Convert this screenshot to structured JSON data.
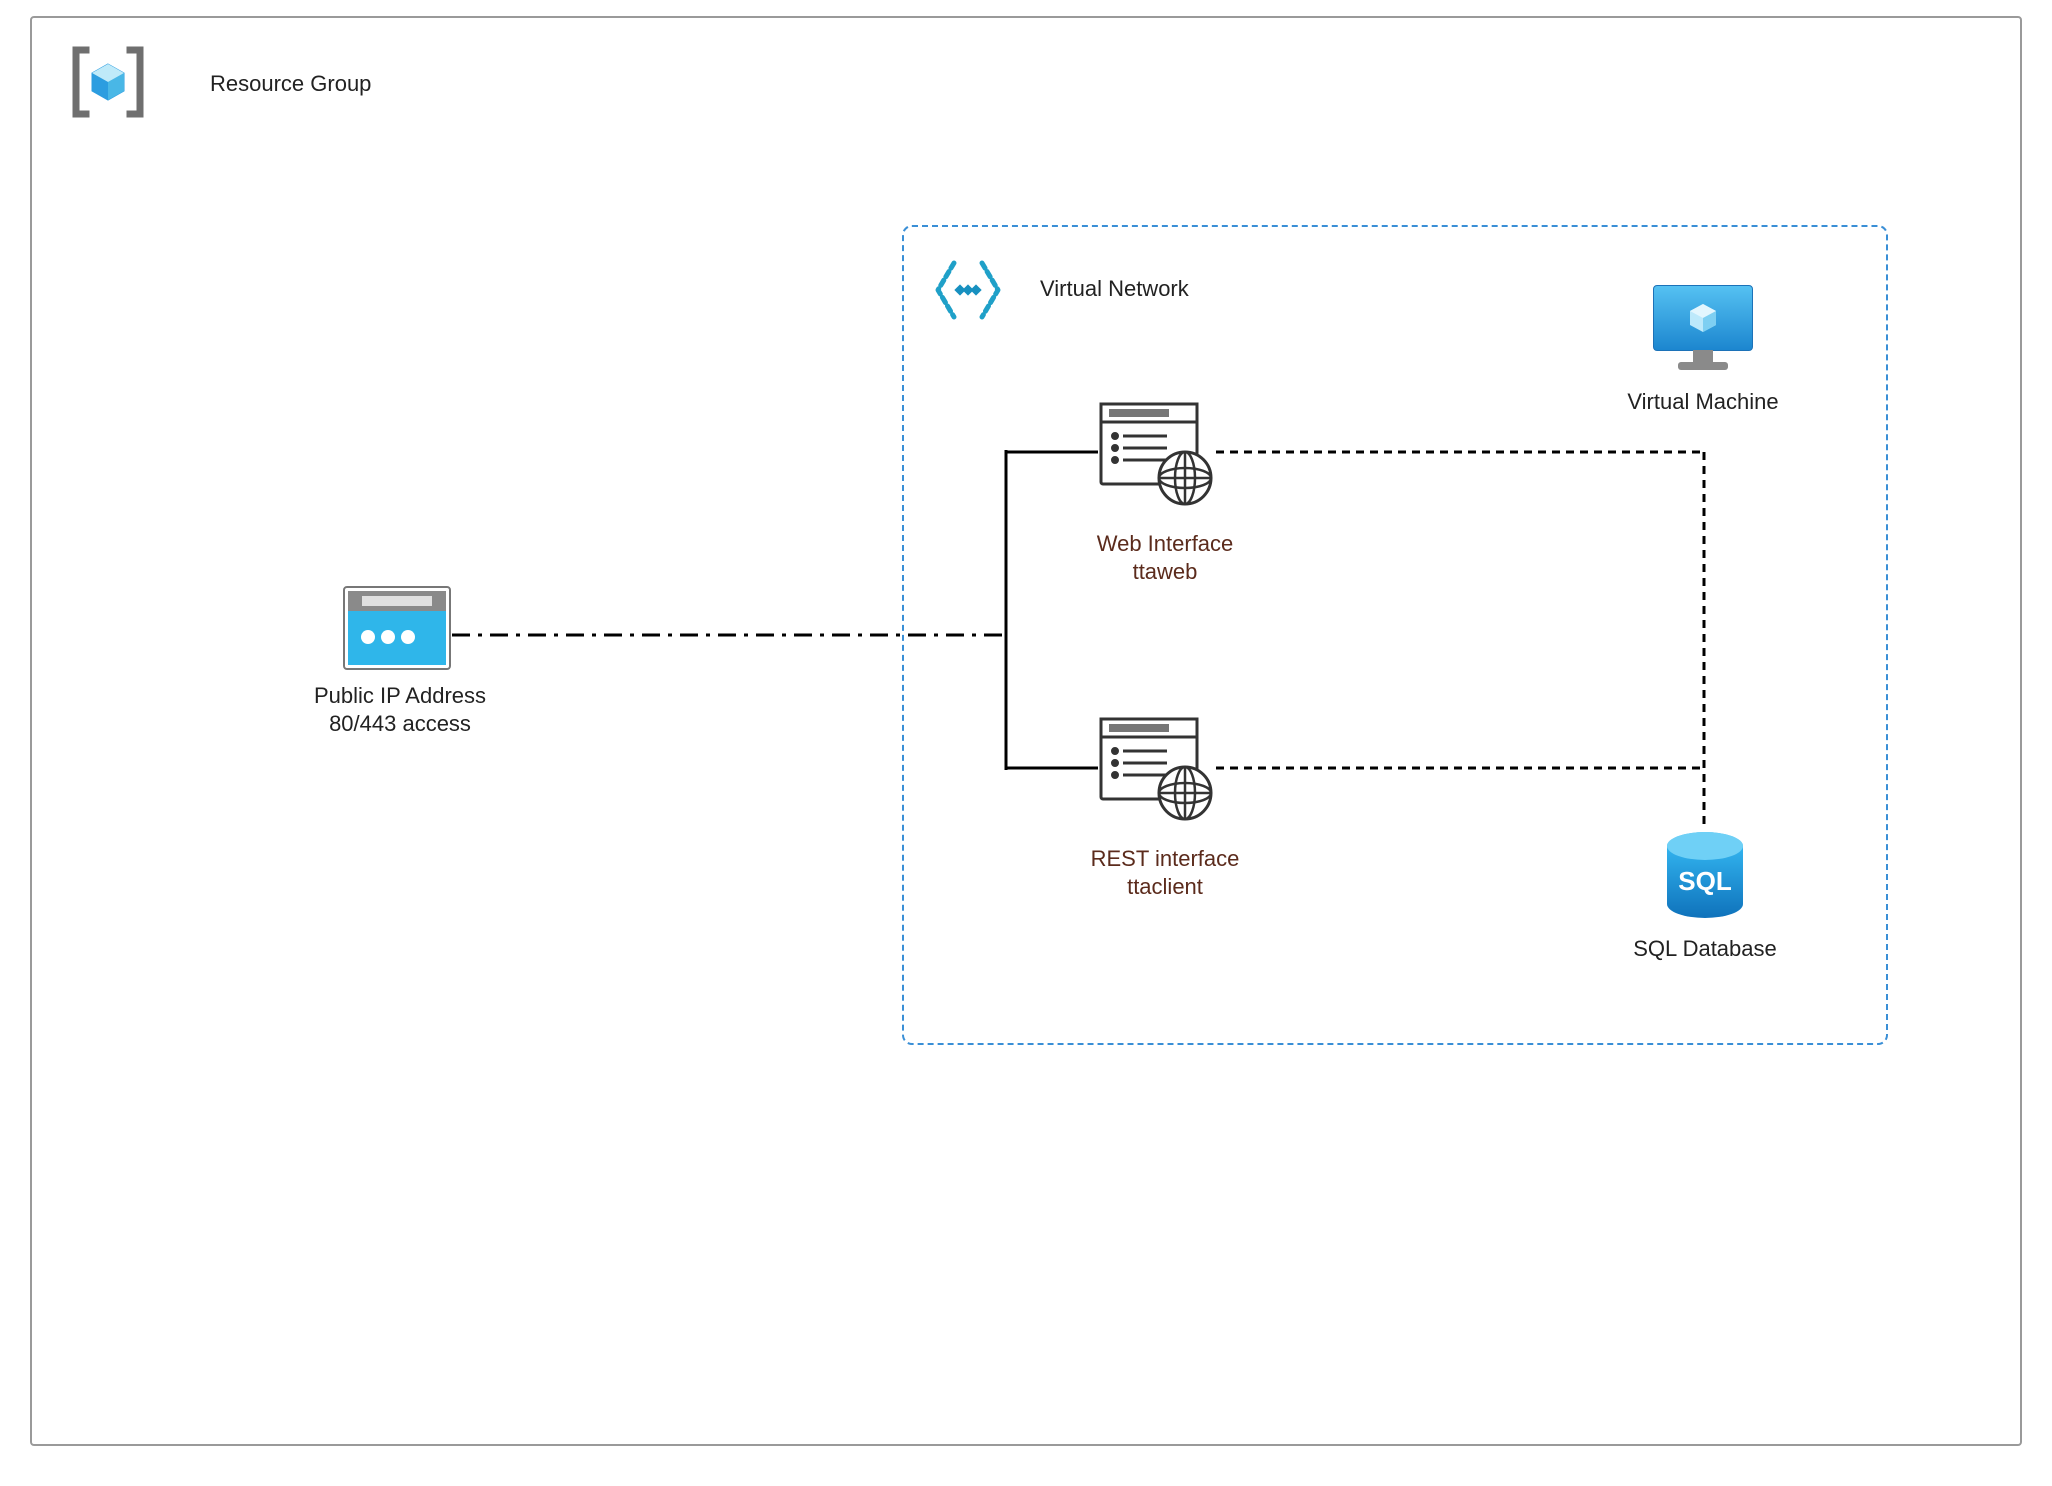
{
  "resource_group": {
    "label": "Resource Group"
  },
  "public_ip": {
    "line1": "Public IP Address",
    "line2": "80/443 access"
  },
  "vnet": {
    "label": "Virtual Network"
  },
  "web_interface": {
    "line1": "Web Interface",
    "line2": "ttaweb"
  },
  "rest_interface": {
    "line1": "REST interface",
    "line2": "ttaclient"
  },
  "virtual_machine": {
    "label": "Virtual Machine"
  },
  "sql_database": {
    "label": "SQL Database",
    "icon_text": "SQL"
  },
  "colors": {
    "azure_blue": "#2C9DE0",
    "azure_dark": "#1C72B8",
    "border_gray": "#9a9a9a",
    "teal": "#1fa0b5",
    "brown_text": "#5b2b1c"
  }
}
